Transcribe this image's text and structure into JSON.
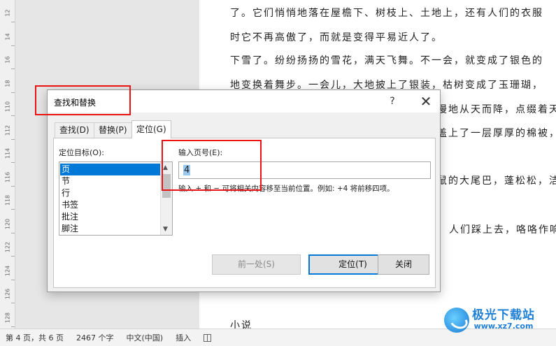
{
  "ruler": {
    "numbers": [
      "12",
      "14",
      "16",
      "18",
      "110",
      "112",
      "114",
      "116",
      "118",
      "120",
      "122",
      "124",
      "126",
      "128"
    ]
  },
  "document": {
    "lines": [
      "了。它们悄悄地落在屋檐下、树枝上、土地上，还有人们的衣服",
      "时它不再高傲了，而就是变得平易近人了。",
      "下雪了。纷纷扬扬的雪花，满天飞舞。不一会，就变成了银色的",
      "地变换着舞步。一会儿，大地披上了银装，枯树变成了玉珊瑚，",
      "漫地从天而降，点缀着天",
      "盖上了一层厚厚的棉被，",
      "鼠的大尾巴，蓬松松，洁",
      "人们踩上去，咯咯作响",
      "小说"
    ]
  },
  "statusbar": {
    "page": "第 4 页，共 6 页",
    "words": "2467 个字",
    "language": "中文(中国)",
    "mode": "插入"
  },
  "watermark": {
    "name": "极光下载站",
    "url": "www.xz7.com"
  },
  "dialog": {
    "title": "查找和替换",
    "help": "?",
    "close": "✕",
    "tabs": [
      {
        "label": "查找(D)"
      },
      {
        "label": "替换(P)"
      },
      {
        "label": "定位(G)"
      }
    ],
    "active_tab": "定位(G)",
    "target_label": "定位目标(O):",
    "target_items": [
      "页",
      "节",
      "行",
      "书签",
      "批注",
      "脚注"
    ],
    "selected_target": "页",
    "page_label": "输入页号(E):",
    "page_value": "4",
    "hint": "输入 + 和 − 可将相关内容移至当前位置。例如: +4 将前移四项。",
    "buttons": {
      "previous": "前一处(S)",
      "goto": "定位(T)",
      "close": "关闭"
    }
  },
  "colors": {
    "accent": "#0078d7",
    "annotation": "#e11111"
  }
}
